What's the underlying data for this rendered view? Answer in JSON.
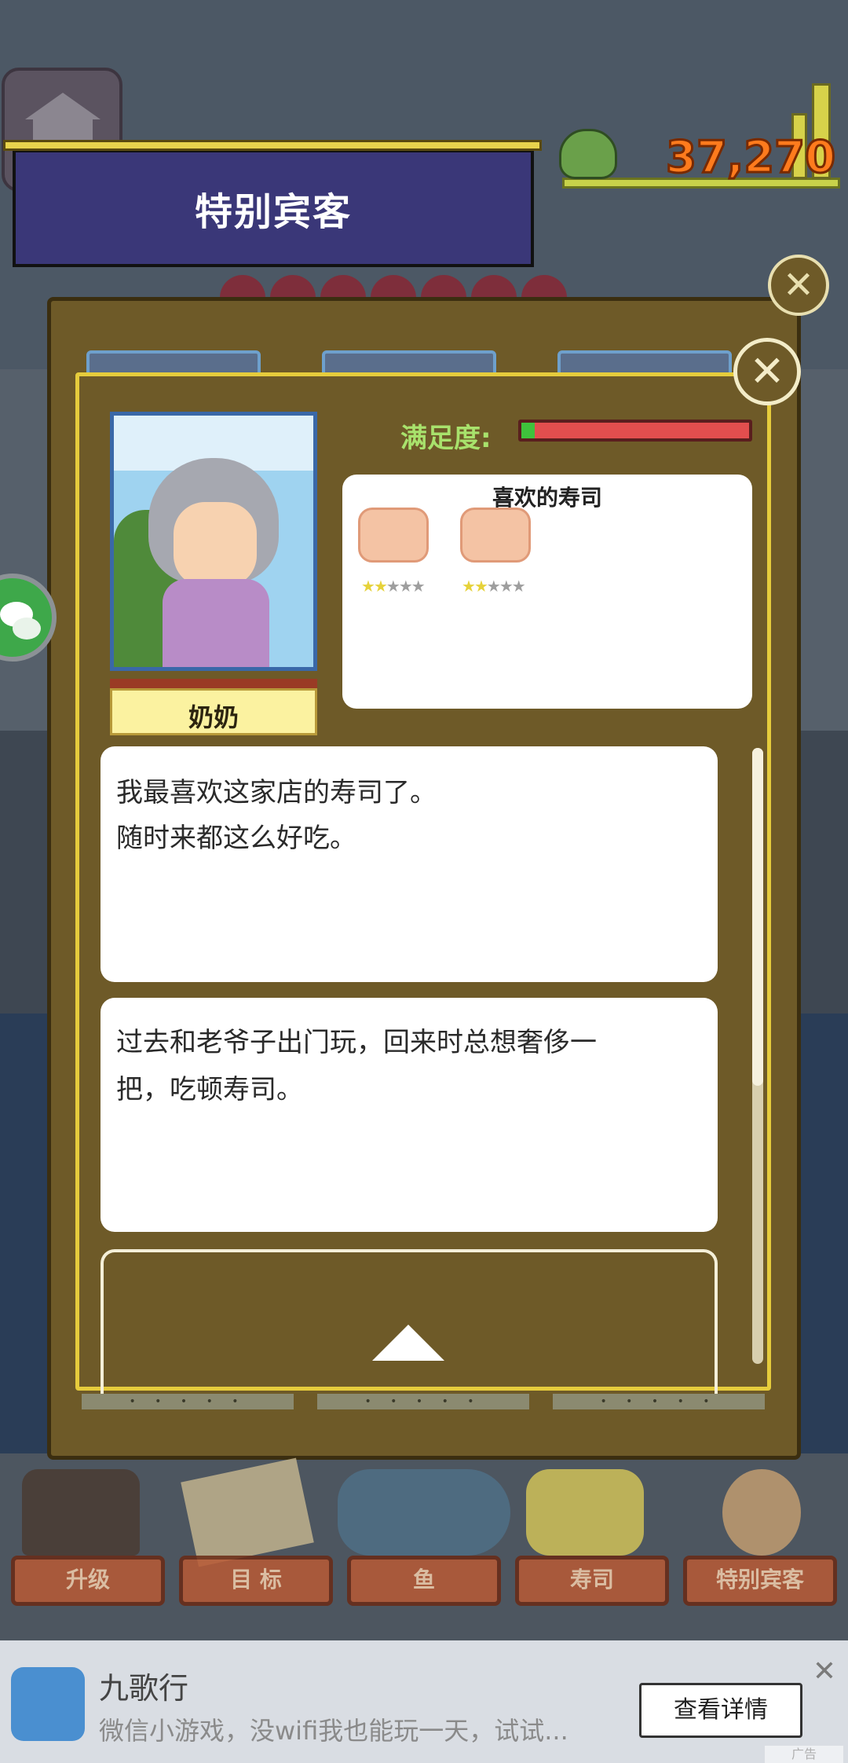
{
  "banner": {
    "title": "特别宾客"
  },
  "money": {
    "value": "37,270"
  },
  "customer": {
    "name": "奶奶",
    "satisfaction_label": "满足度:",
    "satisfaction_fraction": 0.06
  },
  "favorites": {
    "title": "喜欢的寿司",
    "items": [
      {
        "name": "sushi-1",
        "stars_filled": 2,
        "stars_total": 5
      },
      {
        "name": "sushi-2",
        "stars_filled": 2,
        "stars_total": 5
      }
    ]
  },
  "dialogs": [
    {
      "lines": [
        "我最喜欢这家店的寿司了。",
        "随时来都这么好吃。"
      ]
    },
    {
      "lines": [
        "过去和老爷子出门玩，回来时总想奢侈一",
        "把，吃顿寿司。"
      ]
    }
  ],
  "tab_dots": "• • • • •",
  "bottom_menu": [
    {
      "label": "升级",
      "icon": "hammer-icon"
    },
    {
      "label": "目  标",
      "icon": "target-board-icon"
    },
    {
      "label": "鱼",
      "icon": "fish-icon"
    },
    {
      "label": "寿司",
      "icon": "sushi-icon"
    },
    {
      "label": "特别宾客",
      "icon": "guest-icon"
    }
  ],
  "ad": {
    "app_name": "九歌行",
    "description": "微信小游戏，没wifi我也能玩一天，试试...",
    "button_label": "查看详情",
    "close_glyph": "✕",
    "tag": "广告"
  },
  "close_glyph": "✕",
  "colors": {
    "banner": "#3a3778",
    "panel": "#6e5a28",
    "panel_border": "#e6cc3c",
    "money": "#ff7b1d",
    "satisfaction_label": "#a8e26c",
    "bar_red": "#e24e4e",
    "bar_green": "#3fc23c",
    "menu_button": "#b85a35"
  }
}
